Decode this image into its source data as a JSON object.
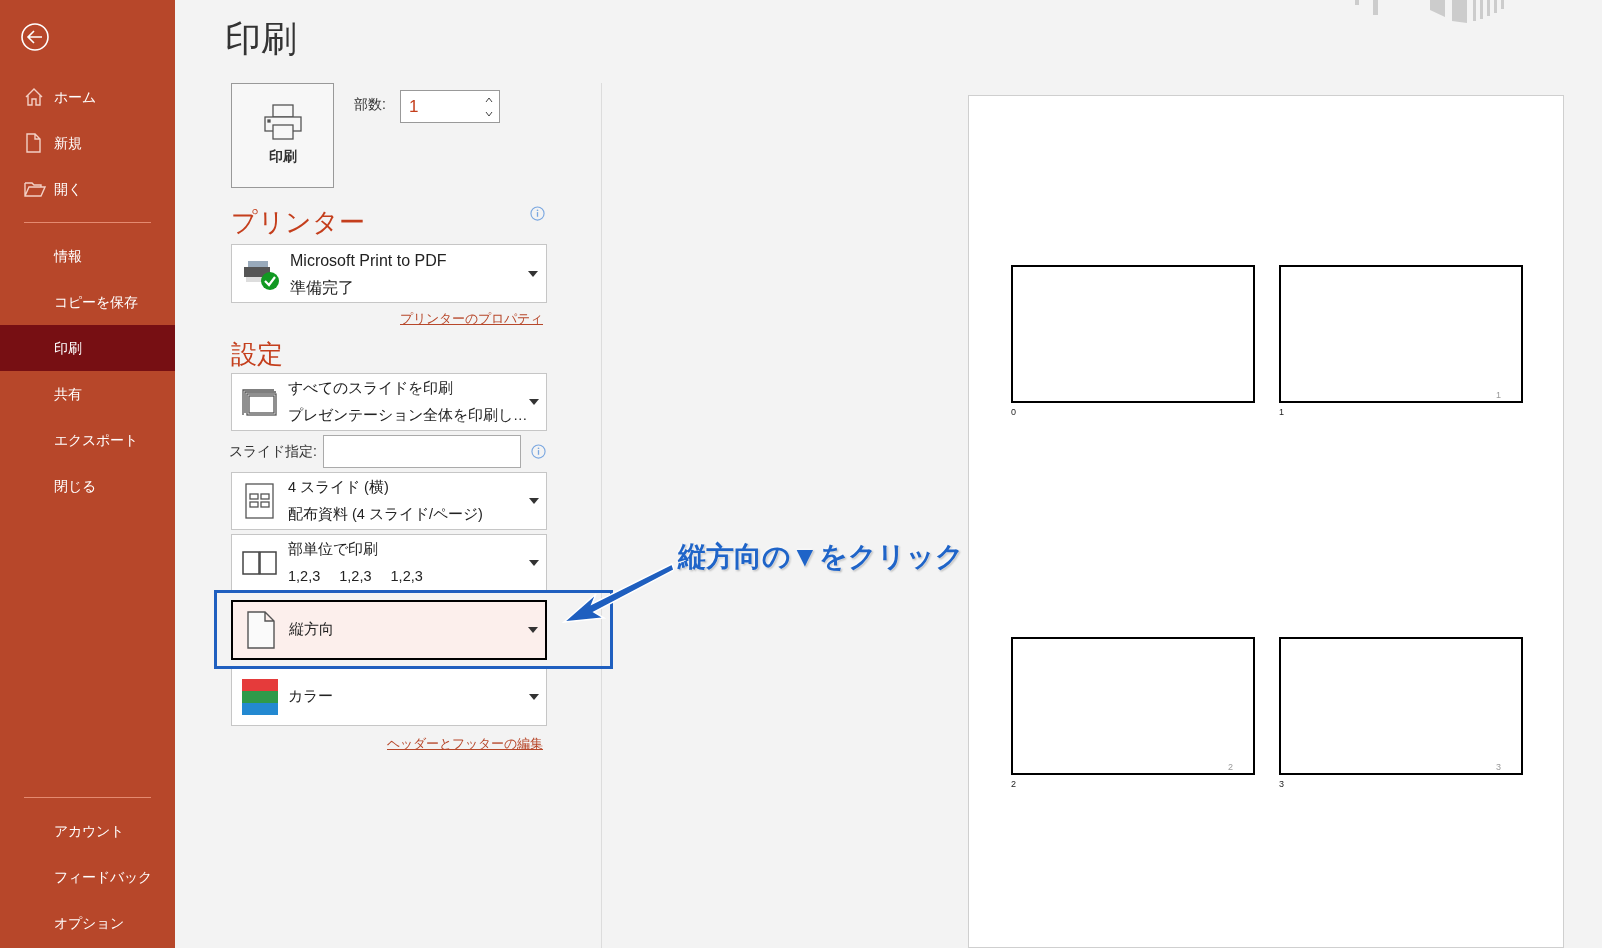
{
  "sidebar": {
    "nav": [
      {
        "label": "ホーム",
        "selected": false
      },
      {
        "label": "新規",
        "selected": false
      },
      {
        "label": "開く",
        "selected": false
      }
    ],
    "main": [
      {
        "label": "情報",
        "selected": false
      },
      {
        "label": "コピーを保存",
        "selected": false
      },
      {
        "label": "印刷",
        "selected": true
      },
      {
        "label": "共有",
        "selected": false
      },
      {
        "label": "エクスポート",
        "selected": false
      },
      {
        "label": "閉じる",
        "selected": false
      }
    ],
    "bottom": [
      {
        "label": "アカウント",
        "selected": false
      },
      {
        "label": "フィードバック",
        "selected": false
      },
      {
        "label": "オプション",
        "selected": false
      }
    ]
  },
  "title": "印刷",
  "print_button": "印刷",
  "copies": {
    "label": "部数:",
    "value": "1"
  },
  "printer": {
    "heading": "プリンター",
    "name": "Microsoft Print to PDF",
    "status": "準備完了",
    "link": "プリンターのプロパティ"
  },
  "settings": {
    "heading": "設定",
    "items": [
      {
        "kind": "dropdown",
        "line1": "すべてのスライドを印刷",
        "line2": "プレゼンテーション全体を印刷し…",
        "highlighted": false
      },
      {
        "kind": "field",
        "label": "スライド指定:"
      },
      {
        "kind": "dropdown",
        "line1": "4 スライド (横)",
        "line2": "配布資料 (4 スライド/ページ)",
        "highlighted": false
      },
      {
        "kind": "dropdown",
        "line1": "部単位で印刷",
        "line2": "1,2,3　 1,2,3　 1,2,3",
        "highlighted": false
      },
      {
        "kind": "dropdown",
        "line1": "縦方向",
        "highlighted": true
      },
      {
        "kind": "dropdown",
        "line1": "カラー",
        "highlighted": false
      }
    ],
    "link": "ヘッダーとフッターの編集"
  },
  "annotation": {
    "text": "縦方向の▼をクリック"
  },
  "preview": {
    "rows": [
      {
        "slides": [
          {
            "label": "0"
          },
          {
            "label": "1",
            "number": "1"
          }
        ]
      },
      {
        "slides": [
          {
            "label": "2",
            "number": "2"
          },
          {
            "label": "3",
            "number": "3"
          }
        ]
      }
    ]
  }
}
